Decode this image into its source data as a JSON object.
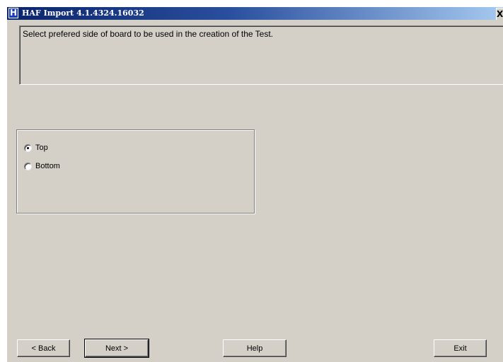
{
  "window": {
    "title": "HAF Import 4.1.4324.16032",
    "icon_letter": "H",
    "close_glyph": "X"
  },
  "instruction": {
    "text": "Select prefered side of board to be used in the creation of the Test."
  },
  "board_side": {
    "options": [
      {
        "label": "Top",
        "selected": true
      },
      {
        "label": "Bottom",
        "selected": false
      }
    ]
  },
  "buttons": {
    "back": "< Back",
    "next": "Next >",
    "help": "Help",
    "exit": "Exit"
  },
  "colors": {
    "face": "#d4d0c8",
    "title_start": "#0a246a",
    "title_end": "#a6caf0"
  }
}
